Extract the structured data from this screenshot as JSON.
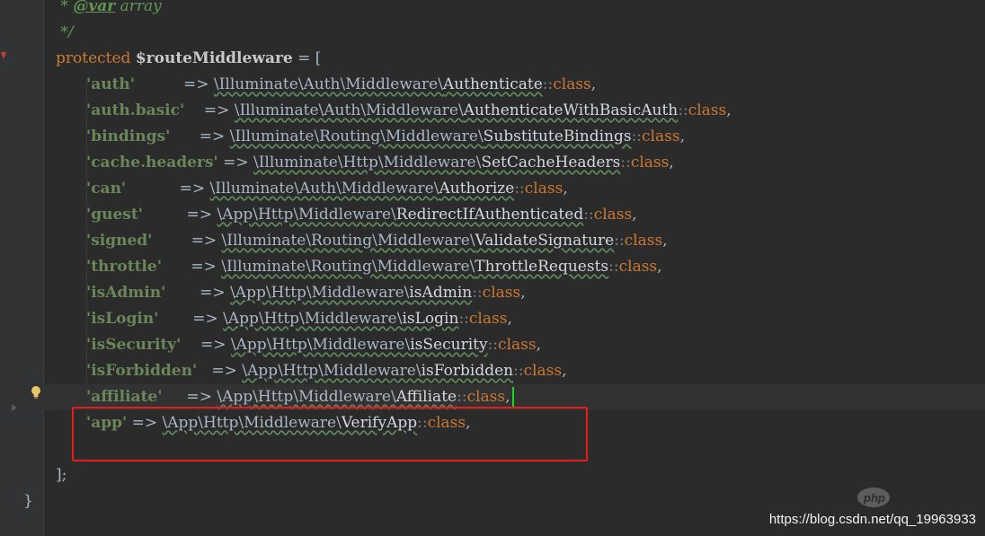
{
  "editor": {
    "doc_lines": [
      {
        "prefix": " * ",
        "tag": "@var",
        "rest": " array"
      },
      {
        "prefix": " */",
        "tag": "",
        "rest": ""
      }
    ],
    "declaration": {
      "keyword": "protected",
      "variable": "$routeMiddleware",
      "assign": " = ["
    },
    "entries": [
      {
        "key": "'auth'",
        "pad": "          ",
        "ns": "\\Illuminate\\Auth\\Middleware\\",
        "cls": "Authenticate"
      },
      {
        "key": "'auth.basic'",
        "pad": "    ",
        "ns": "\\Illuminate\\Auth\\Middleware\\",
        "cls": "AuthenticateWithBasicAuth"
      },
      {
        "key": "'bindings'",
        "pad": "      ",
        "ns": "\\Illuminate\\Routing\\Middleware\\",
        "cls": "SubstituteBindings"
      },
      {
        "key": "'cache.headers'",
        "pad": " ",
        "ns": "\\Illuminate\\Http\\Middleware\\",
        "cls": "SetCacheHeaders"
      },
      {
        "key": "'can'",
        "pad": "           ",
        "ns": "\\Illuminate\\Auth\\Middleware\\",
        "cls": "Authorize"
      },
      {
        "key": "'guest'",
        "pad": "         ",
        "ns": "\\App\\Http\\Middleware\\",
        "cls": "RedirectIfAuthenticated"
      },
      {
        "key": "'signed'",
        "pad": "        ",
        "ns": "\\Illuminate\\Routing\\Middleware\\",
        "cls": "ValidateSignature"
      },
      {
        "key": "'throttle'",
        "pad": "      ",
        "ns": "\\Illuminate\\Routing\\Middleware\\",
        "cls": "ThrottleRequests"
      },
      {
        "key": "'isAdmin'",
        "pad": "       ",
        "ns": "\\App\\Http\\Middleware\\",
        "cls": "isAdmin"
      },
      {
        "key": "'isLogin'",
        "pad": "       ",
        "ns": "\\App\\Http\\Middleware\\",
        "cls": "isLogin"
      },
      {
        "key": "'isSecurity'",
        "pad": "    ",
        "ns": "\\App\\Http\\Middleware\\",
        "cls": "isSecurity"
      },
      {
        "key": "'isForbidden'",
        "pad": "   ",
        "ns": "\\App\\Http\\Middleware\\",
        "cls": "isForbidden"
      },
      {
        "key": "'affiliate'",
        "pad": "     ",
        "ns": "\\App\\Http\\Middleware\\",
        "cls": "Affiliate"
      },
      {
        "key": "'app'",
        "pad": " ",
        "ns": "\\App\\Http\\Middleware\\",
        "cls": "VerifyApp"
      }
    ],
    "arrow": "=>",
    "suffix_sep": "::",
    "suffix_kw": "class",
    "suffix_comma": ",",
    "close_array": "];",
    "close_class": "}"
  },
  "watermark": {
    "text": "https://blog.csdn.net/qq_19963933"
  },
  "colors": {
    "highlight_box": "#e81c1c",
    "caret": "#1ed91e"
  },
  "icons": [
    "lightbulb-icon",
    "override-marker-icon",
    "fold-arrow-icon"
  ]
}
